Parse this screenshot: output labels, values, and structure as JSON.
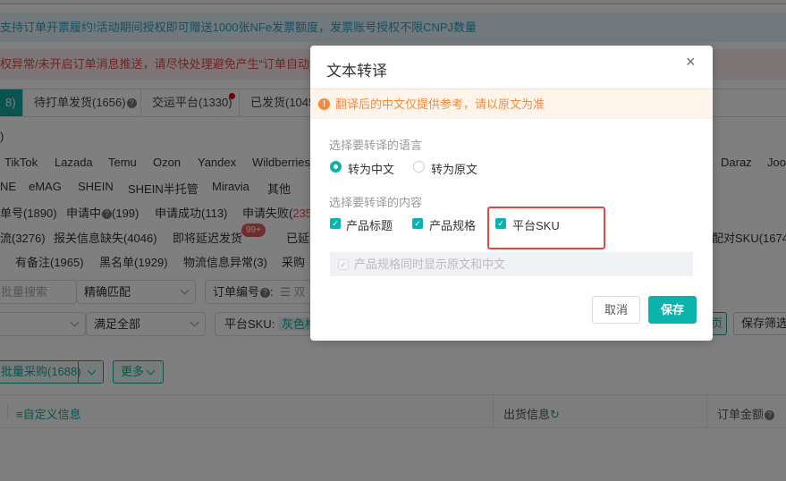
{
  "banners": {
    "info": "支持订单开票履约!活动期间授权即可赠送1000张NFe发票额度，发票账号授权不限CNPJ数量",
    "warning": "权异常/未开启订单消息推送，请尽快处理避免产生“订单自动同"
  },
  "tabs": [
    {
      "label": "8)"
    },
    {
      "label": "待打单发货(1656)"
    },
    {
      "label": "交运平台(1330)"
    },
    {
      "label": "已发货(1045"
    }
  ],
  "row_paren": ")",
  "platforms_row1": [
    "TikTok",
    "Lazada",
    "Temu",
    "Ozon",
    "Yandex",
    "Wildberries",
    "Daraz",
    "Joo"
  ],
  "platforms_row2": [
    "NE",
    "eMAG",
    "SHEIN",
    "SHEIN半托管",
    "Miravia",
    "其他"
  ],
  "status_row": {
    "a": "单号(1890)",
    "b": "申请中",
    "b_count": "(199)",
    "c": "申请成功(113)",
    "d": "申请失败(",
    "d_count": "235"
  },
  "flags_row1": {
    "a": "流(3276)",
    "b": "报关信息缺失(4046)",
    "c": "即将延迟发货",
    "c_badge": "99+",
    "d": "已延",
    "e": "配对SKU(1674"
  },
  "flags_row2": {
    "a": "有备注(1965)",
    "b": "黑名单(1929)",
    "c": "物流信息异常(3)",
    "d": "采购"
  },
  "filters": {
    "batch_search_placeholder": "批量搜索",
    "match_mode": "精确匹配",
    "order_no_label": "订单编号",
    "order_no_placeholder": "双",
    "condition": "满足全部",
    "platform_sku_label": "平台SKU:",
    "platform_sku_tag": "灰色格",
    "page_btn": "页",
    "save_filter_btn": "保存筛选"
  },
  "actions": {
    "batch_purchase": "批量采购(1688)",
    "more": "更多"
  },
  "table_header": {
    "custom_info": "自定义信息",
    "shipping_info": "出货信息",
    "order_amount": "订单金额"
  },
  "modal": {
    "title": "文本转译",
    "close": "×",
    "warning": "翻译后的中文仅提供参考，请以原文为准",
    "language_label": "选择要转译的语言",
    "language_options": [
      {
        "label": "转为中文",
        "selected": true
      },
      {
        "label": "转为原文",
        "selected": false
      }
    ],
    "content_label": "选择要转译的内容",
    "content_options": [
      {
        "label": "产品标题",
        "checked": true
      },
      {
        "label": "产品规格",
        "checked": true
      },
      {
        "label": "平台SKU",
        "checked": true
      }
    ],
    "show_both_label": "产品规格同时显示原文和中文",
    "cancel": "取消",
    "save": "保存"
  },
  "colors": {
    "accent": "#0ab3ac",
    "warning": "#f6893b",
    "highlight": "#e8453c"
  }
}
